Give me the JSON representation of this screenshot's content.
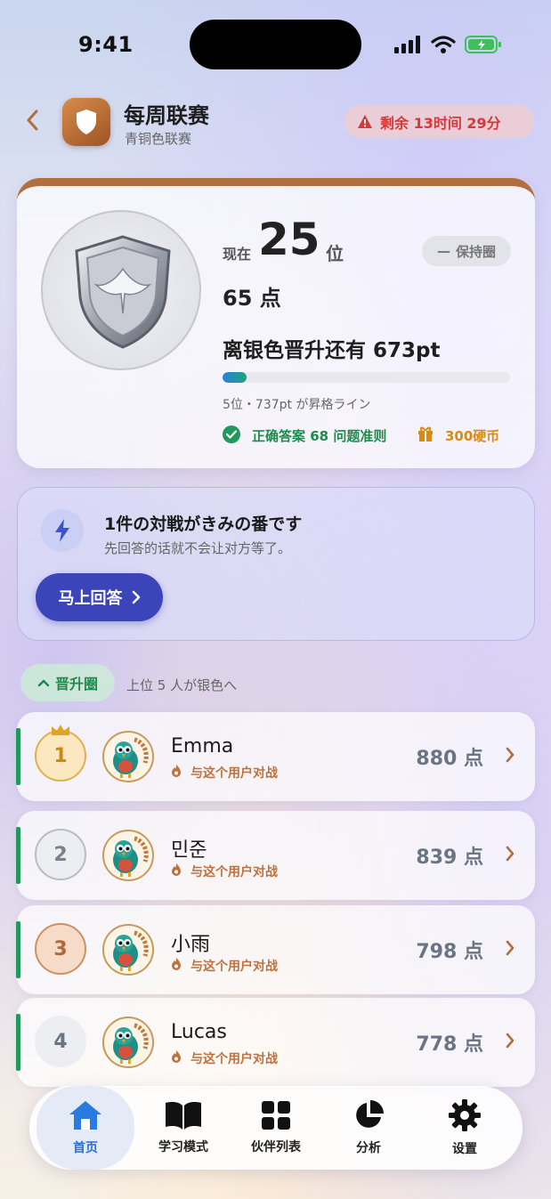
{
  "status_bar": {
    "time": "9:41"
  },
  "header": {
    "title": "每周联赛",
    "subtitle": "青铜色联赛",
    "timer": "剩余 13时间 29分"
  },
  "rank_card": {
    "now_label": "现在",
    "rank": "25",
    "rank_unit": "位",
    "status": "保持圈",
    "points": "65 点",
    "promotion_text": "离银色晋升还有 673pt",
    "progress": 0.085,
    "line_note": "5位・737pt が昇格ライン",
    "requirement": "正确答案 68 问题准则",
    "reward": "300硬币"
  },
  "match_card": {
    "title": "1件の対戦がきみの番です",
    "subtitle": "先回答的话就不会让对方等了。",
    "button": "马上回答"
  },
  "zone": {
    "label": "晋升圈",
    "note": "上位 5 人が银色へ"
  },
  "leaderboard": [
    {
      "rank": "1",
      "name": "Emma",
      "action": "与这个用户对战",
      "score": "880 点"
    },
    {
      "rank": "2",
      "name": "민준",
      "action": "与这个用户对战",
      "score": "839 点"
    },
    {
      "rank": "3",
      "name": "小雨",
      "action": "与这个用户对战",
      "score": "798 点"
    },
    {
      "rank": "4",
      "name": "Lucas",
      "action": "与这个用户对战",
      "score": "778 点"
    }
  ],
  "tabs": [
    {
      "label": "首页",
      "icon": "home-icon"
    },
    {
      "label": "学习模式",
      "icon": "book-icon"
    },
    {
      "label": "伙伴列表",
      "icon": "grid-icon"
    },
    {
      "label": "分析",
      "icon": "pie-chart-icon"
    },
    {
      "label": "设置",
      "icon": "gear-icon"
    }
  ],
  "colors": {
    "accent": "#3b44b8",
    "promotion_green": "#1f9a5a",
    "timer_red": "#d23a3a",
    "bronze": "#b06f3c",
    "coin_gold": "#d98a12"
  }
}
